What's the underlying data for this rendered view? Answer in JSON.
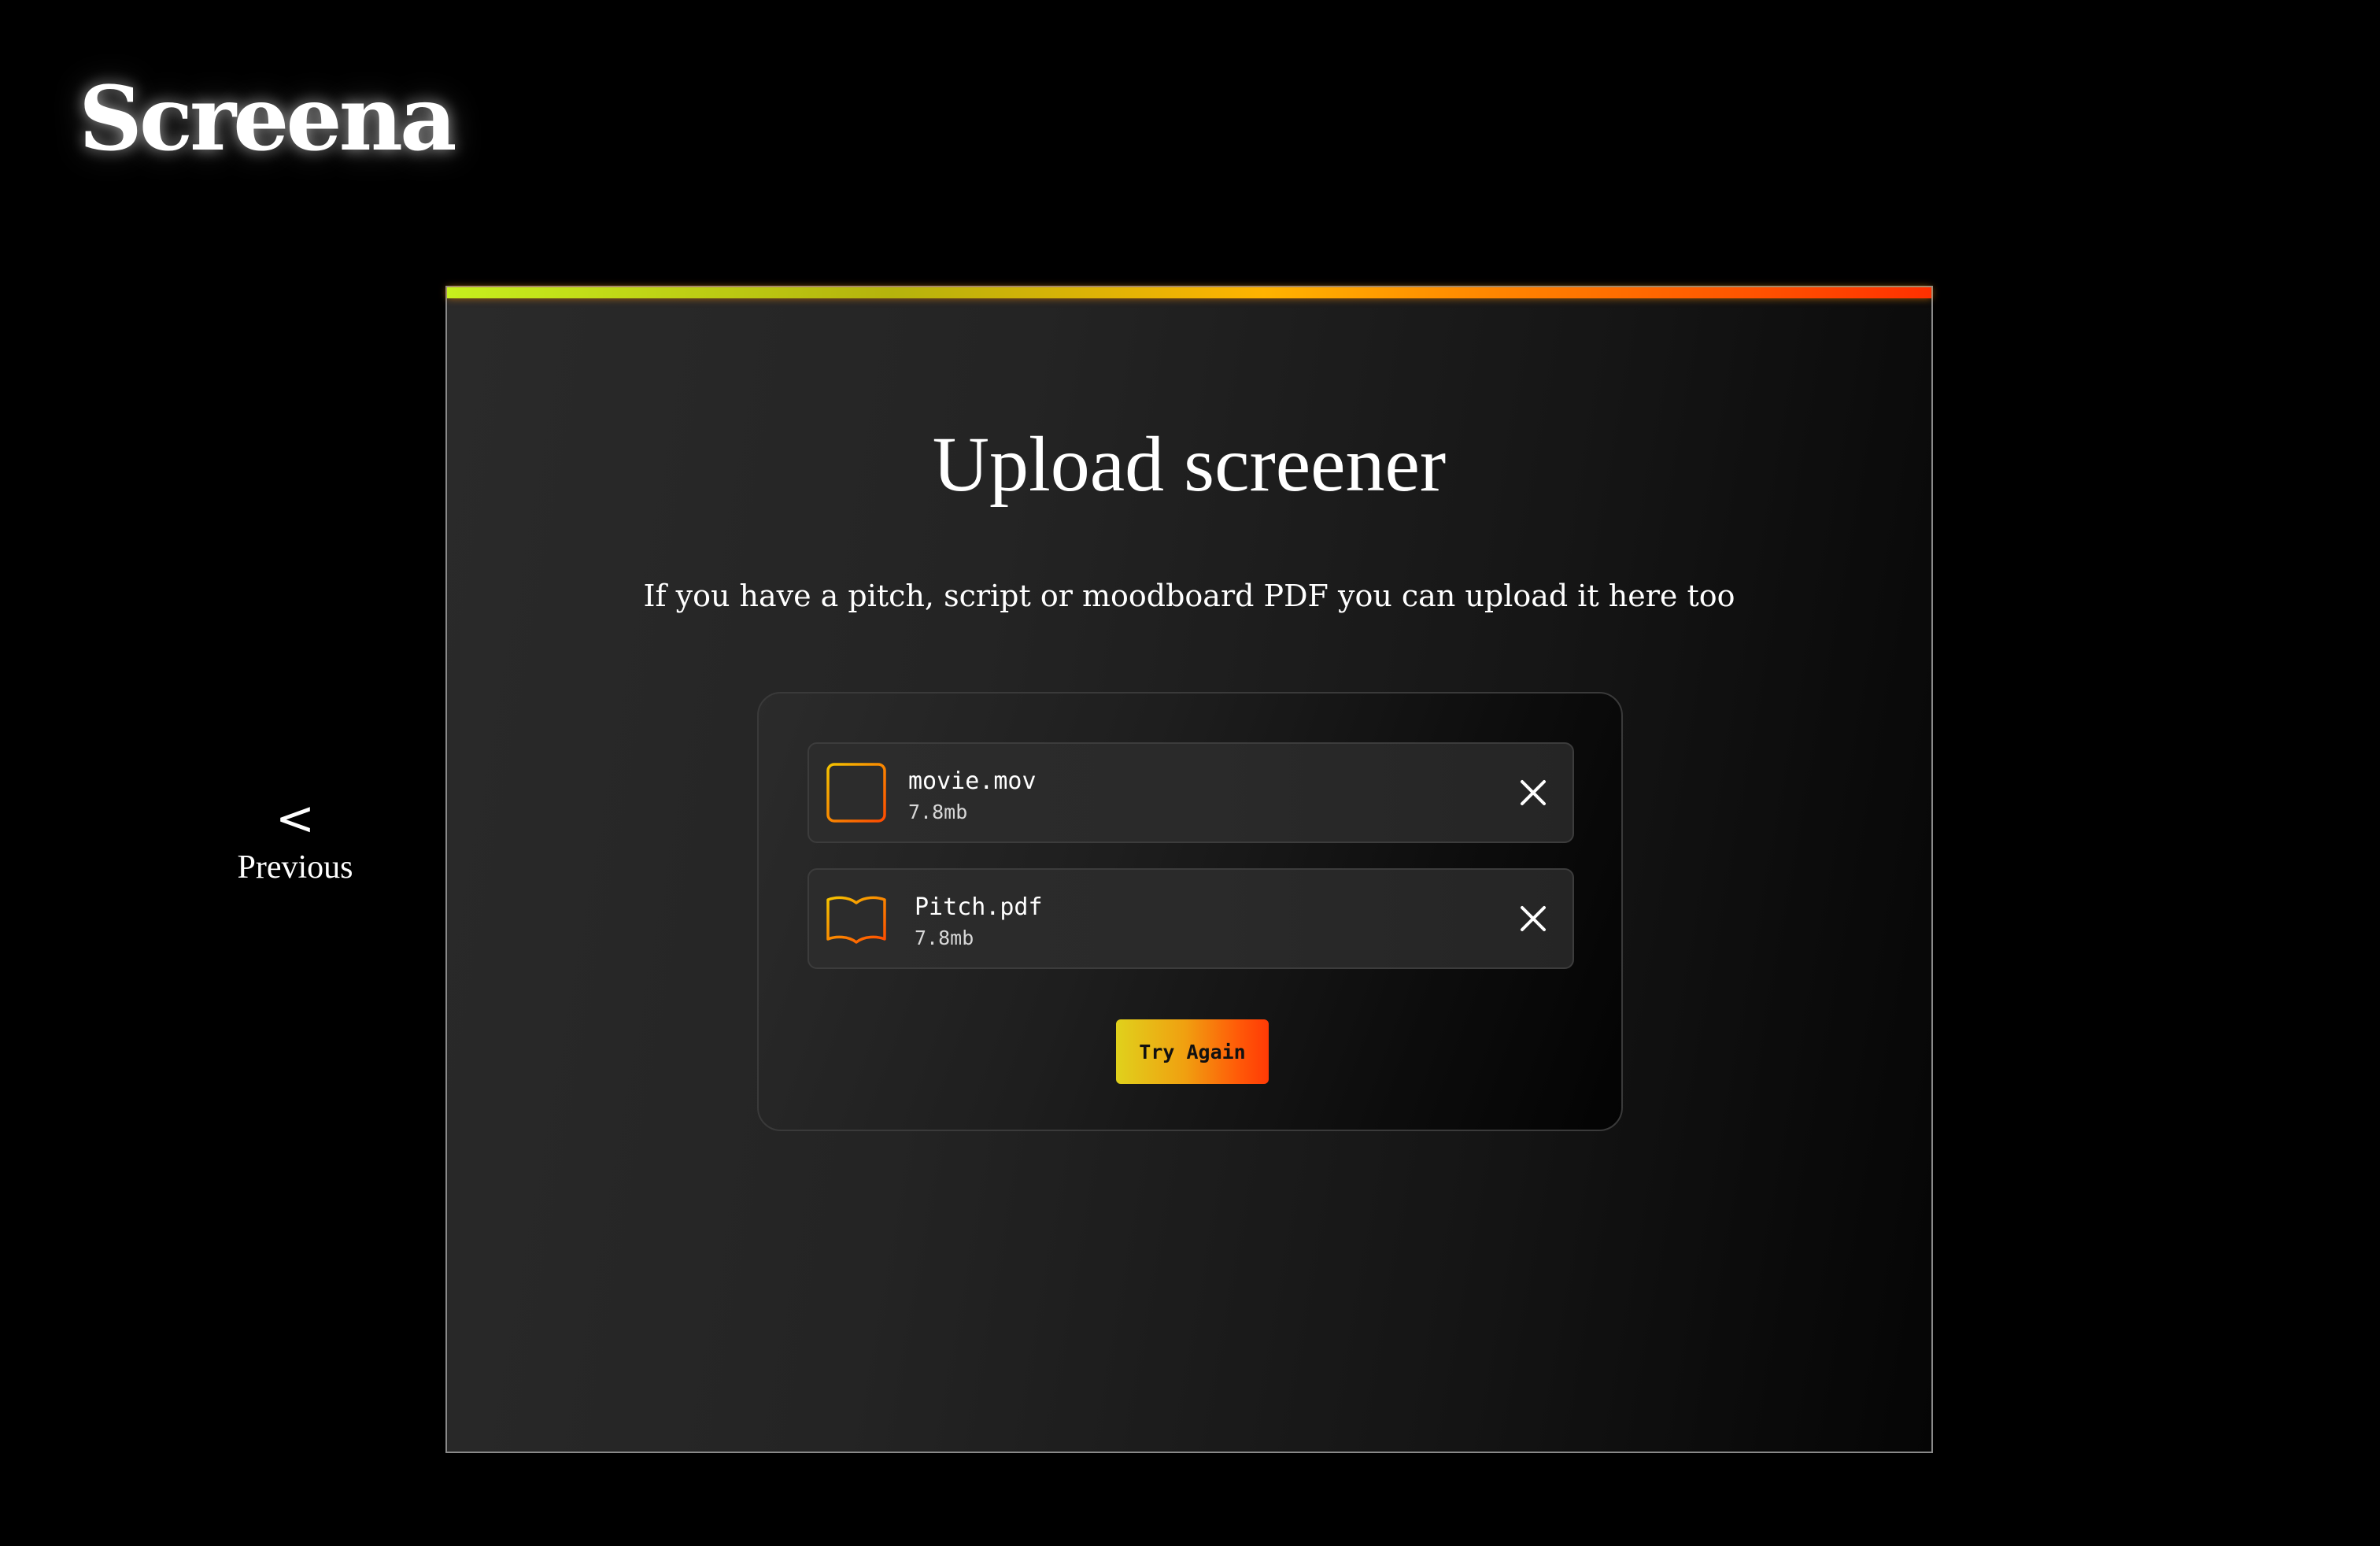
{
  "brand": {
    "logo_text": "Screena"
  },
  "nav": {
    "previous_arrow": "<",
    "previous_label": "Previous"
  },
  "panel": {
    "title": "Upload screener",
    "subtitle": "If you have a pitch, script or moodboard PDF you can upload it here too",
    "files": [
      {
        "name": "movie.mov",
        "size": "7.8mb",
        "icon": "film-icon"
      },
      {
        "name": "Pitch.pdf",
        "size": "7.8mb",
        "icon": "book-icon"
      }
    ],
    "try_again_label": "Try Again"
  },
  "colors": {
    "background": "#000000",
    "panel_bg": "#242424",
    "accent_start": "#c7f01d",
    "accent_mid": "#ffb300",
    "accent_end": "#ff3000",
    "icon_gradient_start": "#f5c400",
    "icon_gradient_end": "#ff4a00"
  }
}
